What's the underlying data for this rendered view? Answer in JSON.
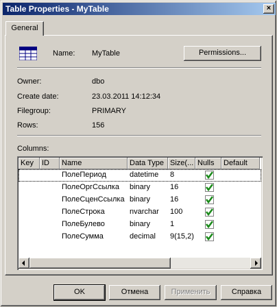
{
  "window": {
    "title": "Table Properties - MyTable",
    "close_glyph": "×"
  },
  "tabs": [
    {
      "label": "General"
    }
  ],
  "general": {
    "name_label": "Name:",
    "name_value": "MyTable",
    "permissions_label": "Permissions...",
    "owner_label": "Owner:",
    "owner_value": "dbo",
    "create_date_label": "Create date:",
    "create_date_value": "23.03.2011 14:12:34",
    "filegroup_label": "Filegroup:",
    "filegroup_value": "PRIMARY",
    "rows_label": "Rows:",
    "rows_value": "156",
    "columns_label": "Columns:"
  },
  "columns_grid": {
    "headers": [
      "Key",
      "ID",
      "Name",
      "Data Type",
      "Size(...",
      "Nulls",
      "Default"
    ],
    "rows": [
      {
        "key": "",
        "id": "",
        "name": "ПолеПериод",
        "type": "datetime",
        "size": "8",
        "nulls": true,
        "default": ""
      },
      {
        "key": "",
        "id": "",
        "name": "ПолеОргСсылка",
        "type": "binary",
        "size": "16",
        "nulls": true,
        "default": ""
      },
      {
        "key": "",
        "id": "",
        "name": "ПолеСценСсылка",
        "type": "binary",
        "size": "16",
        "nulls": true,
        "default": ""
      },
      {
        "key": "",
        "id": "",
        "name": "ПолеСтрока",
        "type": "nvarchar",
        "size": "100",
        "nulls": true,
        "default": ""
      },
      {
        "key": "",
        "id": "",
        "name": "ПолеБулево",
        "type": "binary",
        "size": "1",
        "nulls": true,
        "default": ""
      },
      {
        "key": "",
        "id": "",
        "name": "ПолеСумма",
        "type": "decimal",
        "size": "9(15,2)",
        "nulls": true,
        "default": ""
      }
    ],
    "selected_row": 0
  },
  "buttons": {
    "ok": "OK",
    "cancel": "Отмена",
    "apply": "Применить",
    "help": "Справка"
  },
  "colors": {
    "titlebar_start": "#0a246a",
    "titlebar_end": "#a6caf0",
    "check_green": "#1a8a1a",
    "face": "#d4d0c8"
  },
  "icons": {
    "table": "table-icon",
    "check": "checkmark-icon"
  }
}
